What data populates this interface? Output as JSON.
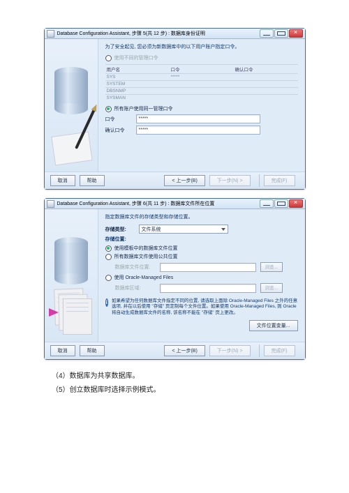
{
  "window1": {
    "title": "Database Configuration Assistant, 步骤 5(共 12 步) : 数据库身份证明",
    "hint": "为了安全起见, 您必须为新数据库中的以下用户账户指定口令。",
    "opt_different": "使用不同的管理口令",
    "table": {
      "h_user": "用户名",
      "h_pass": "口令",
      "h_confirm": "确认口令",
      "rows": [
        {
          "user": "SYS",
          "pass": "*****",
          "confirm": ""
        },
        {
          "user": "SYSTEM",
          "pass": "",
          "confirm": ""
        },
        {
          "user": "DBSNMP",
          "pass": "",
          "confirm": ""
        },
        {
          "user": "SYSMAN",
          "pass": "",
          "confirm": ""
        }
      ]
    },
    "opt_same": "所有账户使用同一管理口令",
    "lbl_pass": "口令",
    "lbl_confirm": "确认口令",
    "val_pass": "*****",
    "val_confirm": "*****"
  },
  "buttons": {
    "cancel": "取消",
    "help": "帮助",
    "back": "< 上一步(B)",
    "next": "下一步(N) >",
    "finish": "完成(F)"
  },
  "window2": {
    "title": "Database Configuration Assistant, 步骤 6(共 11 步) : 数据库文件所在位置",
    "hint": "指定数据库文件的存储类型和存储位置。",
    "lbl_storetype": "存储类型:",
    "combo_val": "文件系统",
    "lbl_storeloc": "存储位置:",
    "opt_template": "使用模板中的数据库文件位置",
    "opt_common": "所有数据库文件使用公共位置",
    "lbl_dbloc": "数据库文件位置:",
    "opt_omf": "使用 Oracle-Managed Files",
    "lbl_dbarea": "数据库区域:",
    "browse": "浏览...",
    "info": "如果希望为任何数据库文件指定不同的位置, 请选取上面除 Oracle-Managed Files 之外的任意选项, 并在以后使用 \"存储\" 页定制每个文件位置。如果使用 Oracle-Managed Files, 则 Oracle 将自动生成数据库文件的名称, 该名称不能在 \"存储\" 页上更改。",
    "fileloc_btn": "文件位置变量..."
  },
  "notes": {
    "n4": "（4）数据库为共享数据库。",
    "n5": "（5）创立数据库时选择示例模式。"
  }
}
